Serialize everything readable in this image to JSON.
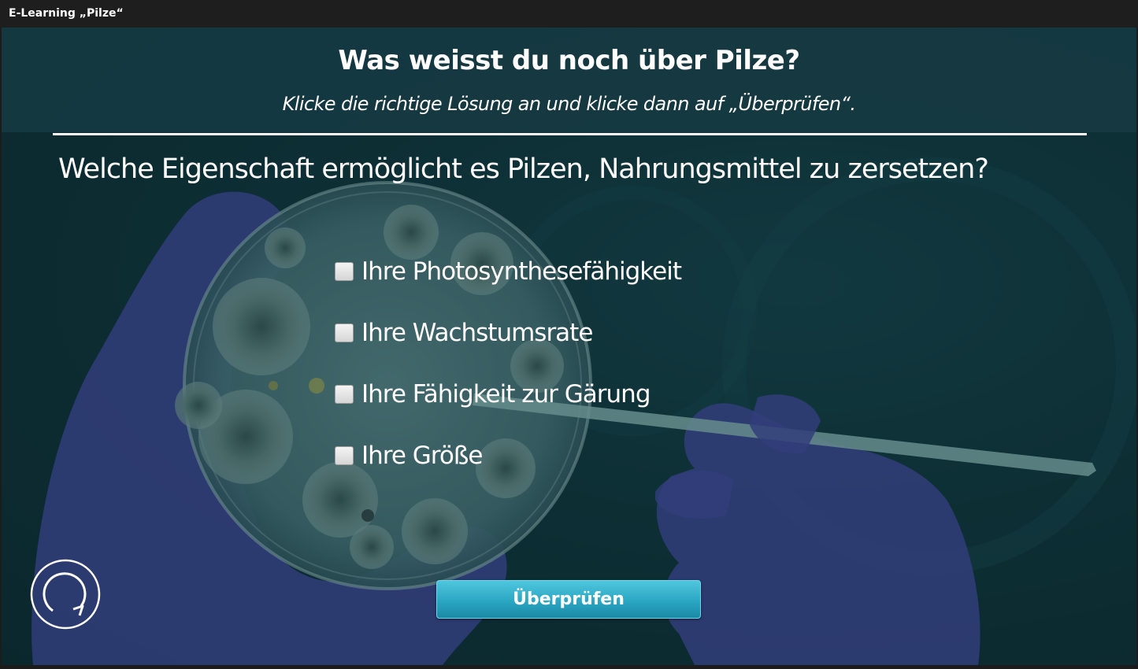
{
  "window": {
    "title": "E-Learning „Pilze“"
  },
  "quiz": {
    "heading": "Was weisst du noch über Pilze?",
    "instruction": "Klicke die richtige Lösung an und klicke dann auf „Überprüfen“.",
    "question": "Welche Eigenschaft ermöglicht es Pilzen, Nahrungsmittel zu zersetzen?",
    "options": [
      {
        "label": "Ihre Photosynthesefähigkeit",
        "checked": false
      },
      {
        "label": "Ihre Wachstumsrate",
        "checked": false
      },
      {
        "label": "Ihre Fähigkeit zur Gärung",
        "checked": false
      },
      {
        "label": "Ihre Größe",
        "checked": false
      }
    ],
    "check_button_label": "Überprüfen"
  },
  "icons": {
    "reset": "reset-icon",
    "checkbox": "checkbox-icon"
  },
  "colors": {
    "background": "#0f3238",
    "header_band": "#163a42",
    "button": "#2ba6c3",
    "glove": "#4a4aa8",
    "text": "#ffffff"
  }
}
